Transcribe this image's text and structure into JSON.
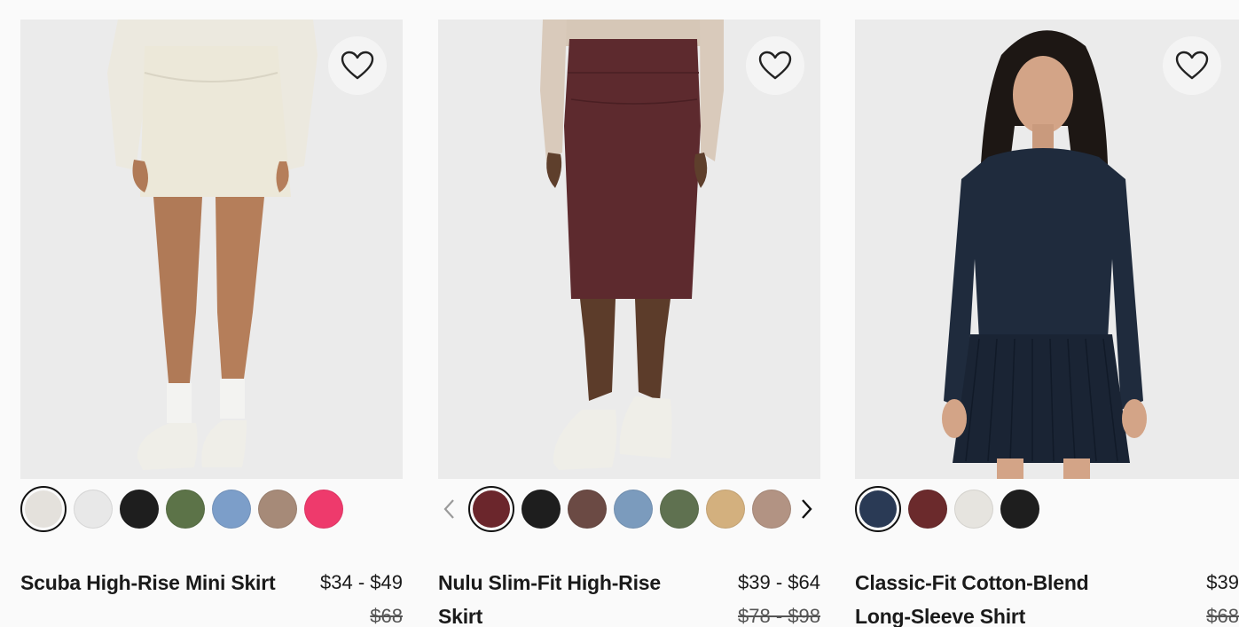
{
  "products": [
    {
      "name": "Scuba High-Rise Mini Skirt",
      "price": "$34 - $49",
      "was_price": "$68",
      "photo_bg": "#ebebeb",
      "swatches": [
        "#e4e1dc",
        "#e8e8e8",
        "#1e1e1e",
        "#5c7348",
        "#7c9ec9",
        "#a68a78",
        "#ee3a6c"
      ],
      "selected_swatch": 0,
      "wishlist_icon": "heart-icon"
    },
    {
      "name": "Nulu Slim-Fit High-Rise Skirt",
      "price": "$39 - $64",
      "was_price": "$78 - $98",
      "photo_bg": "#ebebeb",
      "swatches": [
        "#6b262c",
        "#1e1e1e",
        "#6b4a44",
        "#7b9bbd",
        "#5f7150",
        "#d3b07e",
        "#b29383"
      ],
      "selected_swatch": 0,
      "wishlist_icon": "heart-icon",
      "prev_icon": "chevron-left-icon",
      "next_icon": "chevron-right-icon"
    },
    {
      "name": "Classic-Fit Cotton-Blend Long-Sleeve Shirt",
      "price": "$39",
      "was_price": "$68",
      "photo_bg": "#ebebeb",
      "swatches": [
        "#2a3a55",
        "#6b2a2c",
        "#e6e4df",
        "#1e1e1e"
      ],
      "selected_swatch": 0,
      "wishlist_icon": "heart-icon"
    }
  ]
}
